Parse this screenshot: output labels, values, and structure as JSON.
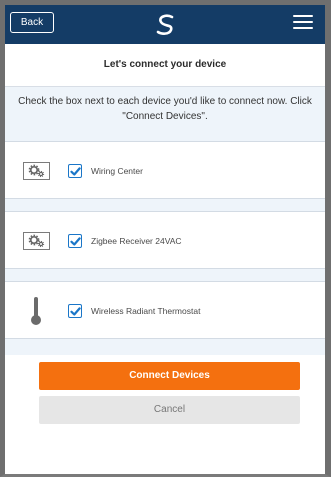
{
  "header": {
    "back_label": "Back",
    "logo_icon": "brand-swirl-icon",
    "menu_icon": "hamburger-menu-icon"
  },
  "title": "Let's connect your device",
  "instructions": "Check the box next to each device you'd like to connect now. Click \"Connect Devices\".",
  "devices": [
    {
      "label": "Wiring Center",
      "icon": "gears-icon",
      "checked": true
    },
    {
      "label": "Zigbee Receiver 24VAC",
      "icon": "gears-icon",
      "checked": true
    },
    {
      "label": "Wireless Radiant Thermostat",
      "icon": "thermometer-icon",
      "checked": true
    }
  ],
  "actions": {
    "connect_label": "Connect Devices",
    "cancel_label": "Cancel"
  },
  "colors": {
    "header_bg": "#143c66",
    "primary": "#f4700f",
    "checkbox": "#1a76c8",
    "section_bg": "#eef4fa"
  }
}
